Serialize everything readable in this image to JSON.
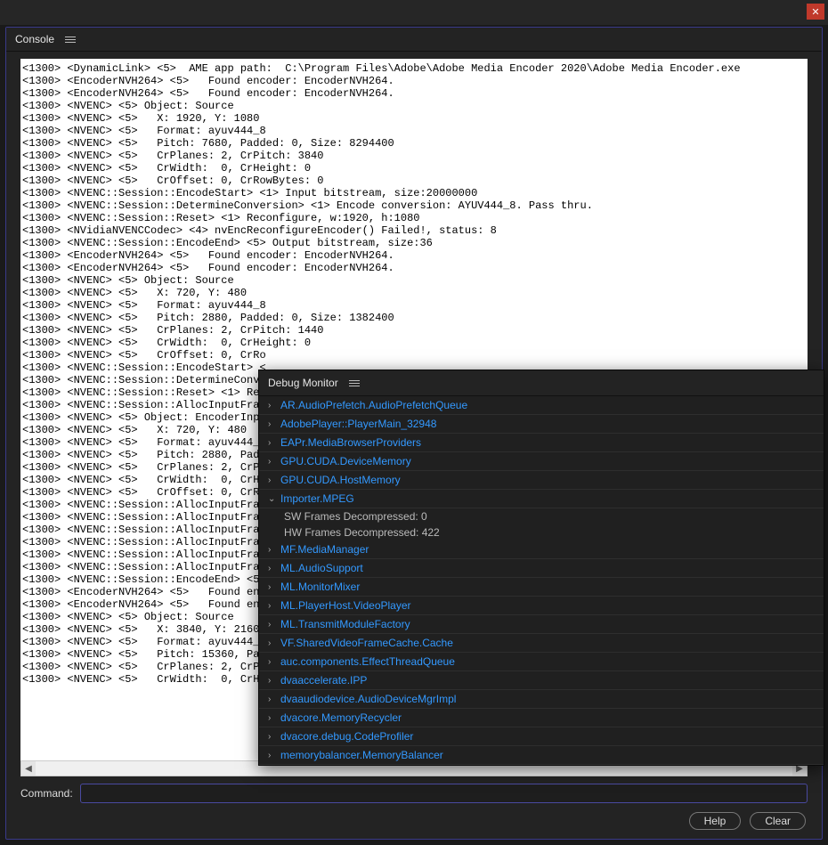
{
  "titlebar": {
    "close": "✕"
  },
  "console": {
    "panel_title": "Console",
    "command_label": "Command:",
    "help_label": "Help",
    "clear_label": "Clear",
    "lines": [
      "<1300> <DynamicLink> <5>  AME app path:  C:\\Program Files\\Adobe\\Adobe Media Encoder 2020\\Adobe Media Encoder.exe",
      "<1300> <EncoderNVH264> <5>   Found encoder: EncoderNVH264.",
      "<1300> <EncoderNVH264> <5>   Found encoder: EncoderNVH264.",
      "<1300> <NVENC> <5> Object: Source",
      "<1300> <NVENC> <5>   X: 1920, Y: 1080",
      "<1300> <NVENC> <5>   Format: ayuv444_8",
      "<1300> <NVENC> <5>   Pitch: 7680, Padded: 0, Size: 8294400",
      "<1300> <NVENC> <5>   CrPlanes: 2, CrPitch: 3840",
      "<1300> <NVENC> <5>   CrWidth:  0, CrHeight: 0",
      "<1300> <NVENC> <5>   CrOffset: 0, CrRowBytes: 0",
      "<1300> <NVENC::Session::EncodeStart> <1> Input bitstream, size:20000000",
      "<1300> <NVENC::Session::DetermineConversion> <1> Encode conversion: AYUV444_8. Pass thru.",
      "<1300> <NVENC::Session::Reset> <1> Reconfigure, w:1920, h:1080",
      "<1300> <NVidiaNVENCCodec> <4> nvEncReconfigureEncoder() Failed!, status: 8",
      "<1300> <NVENC::Session::EncodeEnd> <5> Output bitstream, size:36",
      "<1300> <EncoderNVH264> <5>   Found encoder: EncoderNVH264.",
      "<1300> <EncoderNVH264> <5>   Found encoder: EncoderNVH264.",
      "<1300> <NVENC> <5> Object: Source",
      "<1300> <NVENC> <5>   X: 720, Y: 480",
      "<1300> <NVENC> <5>   Format: ayuv444_8",
      "<1300> <NVENC> <5>   Pitch: 2880, Padded: 0, Size: 1382400",
      "<1300> <NVENC> <5>   CrPlanes: 2, CrPitch: 1440",
      "<1300> <NVENC> <5>   CrWidth:  0, CrHeight: 0",
      "<1300> <NVENC> <5>   CrOffset: 0, CrRo",
      "<1300> <NVENC::Session::EncodeStart> <",
      "<1300> <NVENC::Session::DetermineConve",
      "<1300> <NVENC::Session::Reset> <1> Rec",
      "<1300> <NVENC::Session::AllocInputFram",
      "<1300> <NVENC> <5> Object: EncoderInpu",
      "<1300> <NVENC> <5>   X: 720, Y: 480",
      "<1300> <NVENC> <5>   Format: ayuv444_8",
      "<1300> <NVENC> <5>   Pitch: 2880, Padd",
      "<1300> <NVENC> <5>   CrPlanes: 2, CrPi",
      "<1300> <NVENC> <5>   CrWidth:  0, CrHe",
      "<1300> <NVENC> <5>   CrOffset: 0, CrRo",
      "<1300> <NVENC::Session::AllocInputFram",
      "<1300> <NVENC::Session::AllocInputFram",
      "<1300> <NVENC::Session::AllocInputFram",
      "<1300> <NVENC::Session::AllocInputFram",
      "<1300> <NVENC::Session::AllocInputFram",
      "<1300> <NVENC::Session::AllocInputFram",
      "<1300> <NVENC::Session::EncodeEnd> <5>",
      "<1300> <EncoderNVH264> <5>   Found enc",
      "<1300> <EncoderNVH264> <5>   Found enc",
      "<1300> <NVENC> <5> Object: Source",
      "<1300> <NVENC> <5>   X: 3840, Y: 2160",
      "<1300> <NVENC> <5>   Format: ayuv444_8",
      "<1300> <NVENC> <5>   Pitch: 15360, Pad",
      "<1300> <NVENC> <5>   CrPlanes: 2, CrPi",
      "<1300> <NVENC> <5>   CrWidth:  0, CrHe"
    ]
  },
  "debug_monitor": {
    "panel_title": "Debug Monitor",
    "items": [
      {
        "label": "AR.AudioPrefetch.AudioPrefetchQueue",
        "expanded": false
      },
      {
        "label": "AdobePlayer::PlayerMain_32948",
        "expanded": false
      },
      {
        "label": "EAPr.MediaBrowserProviders",
        "expanded": false
      },
      {
        "label": "GPU.CUDA.DeviceMemory",
        "expanded": false
      },
      {
        "label": "GPU.CUDA.HostMemory",
        "expanded": false
      },
      {
        "label": "Importer.MPEG",
        "expanded": true,
        "sub": [
          "SW Frames Decompressed: 0",
          "HW Frames Decompressed: 422"
        ]
      },
      {
        "label": "MF.MediaManager",
        "expanded": false
      },
      {
        "label": "ML.AudioSupport",
        "expanded": false
      },
      {
        "label": "ML.MonitorMixer",
        "expanded": false
      },
      {
        "label": "ML.PlayerHost.VideoPlayer",
        "expanded": false
      },
      {
        "label": "ML.TransmitModuleFactory",
        "expanded": false
      },
      {
        "label": "VF.SharedVideoFrameCache.Cache",
        "expanded": false
      },
      {
        "label": "auc.components.EffectThreadQueue",
        "expanded": false
      },
      {
        "label": "dvaaccelerate.IPP",
        "expanded": false
      },
      {
        "label": "dvaaudiodevice.AudioDeviceMgrImpl",
        "expanded": false
      },
      {
        "label": "dvacore.MemoryRecycler",
        "expanded": false
      },
      {
        "label": "dvacore.debug.CodeProfiler",
        "expanded": false
      },
      {
        "label": "memorybalancer.MemoryBalancer",
        "expanded": false
      }
    ]
  }
}
